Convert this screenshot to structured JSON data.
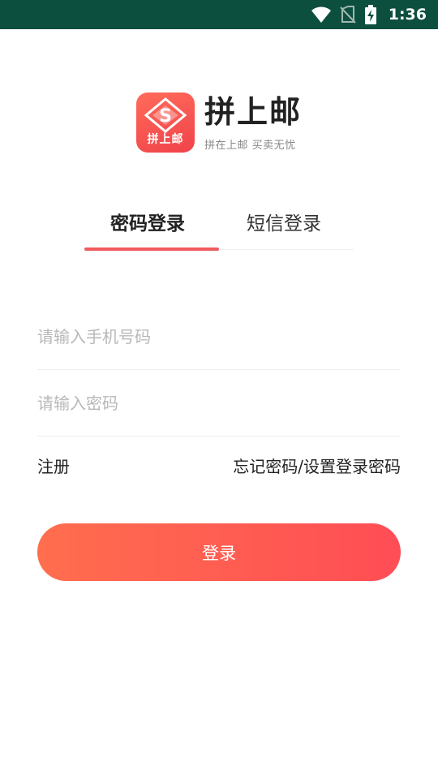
{
  "status_bar": {
    "time": "1:36",
    "icons": [
      "wifi-icon",
      "no-sim-icon",
      "battery-charging-icon"
    ]
  },
  "brand": {
    "icon_label": "拼上邮",
    "name": "拼上邮",
    "slogan": "拼在上邮 买卖无忧",
    "accent_color": "#f0434a"
  },
  "tabs": {
    "items": [
      {
        "label": "密码登录",
        "active": true
      },
      {
        "label": "短信登录",
        "active": false
      }
    ],
    "indicator_color": "#f05a5e"
  },
  "form": {
    "phone_placeholder": "请输入手机号码",
    "phone_value": "",
    "password_placeholder": "请输入密码",
    "password_value": ""
  },
  "links": {
    "register": "注册",
    "forgot": "忘记密码/设置登录密码"
  },
  "login_button": {
    "label": "登录",
    "gradient_start": "#ff6e4e",
    "gradient_end": "#ff4d55"
  }
}
